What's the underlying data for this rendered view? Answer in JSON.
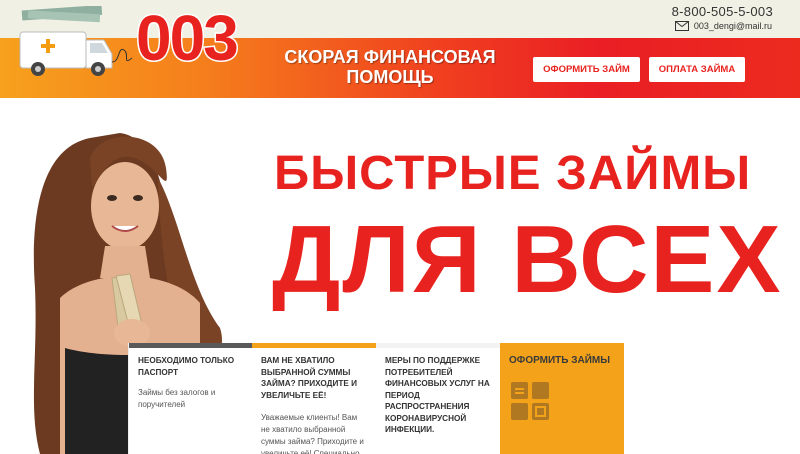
{
  "contact": {
    "phone": "8-800-505-5-003",
    "email": "003_dengi@mail.ru",
    "email_icon": "envelope-icon"
  },
  "header": {
    "logo_number": "003",
    "brand_line1": "СКОРАЯ ФИНАНСОВАЯ",
    "brand_line2": "ПОМОЩЬ",
    "apply_button": "ОФОРМИТЬ ЗАЙМ",
    "pay_button": "ОПЛАТА ЗАЙМА",
    "colors": {
      "accent": "#e8231f",
      "orange": "#f7a11d",
      "panel_orange": "#f3a21a"
    }
  },
  "hero": {
    "headline_line1": "БЫСТРЫЕ ЗАЙМЫ",
    "headline_line2": "ДЛЯ ВСЕХ"
  },
  "panels": [
    {
      "title": "НЕОБХОДИМО ТОЛЬКО ПАСПОРТ",
      "text": "Займы без залогов и поручителей"
    },
    {
      "title": "ВАМ НЕ ХВАТИЛО ВЫБРАННОЙ СУММЫ ЗАЙМА? ПРИХОДИТЕ И УВЕЛИЧЬТЕ ЕЁ!",
      "text": "Уважаемые клиенты! Вам не хватило выбранной суммы займа? Приходите и увеличьте её! Специально"
    },
    {
      "title": "МЕРЫ ПО ПОДДЕРЖКЕ ПОТРЕБИТЕЛЕЙ ФИНАНСОВЫХ УСЛУГ НА ПЕРИОД РАСПРОСТРАНЕНИЯ КОРОНАВИРУСНОЙ ИНФЕКЦИИ.",
      "text": ""
    },
    {
      "title": "ОФОРМИТЬ ЗАЙМЫ",
      "icon": "calculator-icon"
    }
  ]
}
